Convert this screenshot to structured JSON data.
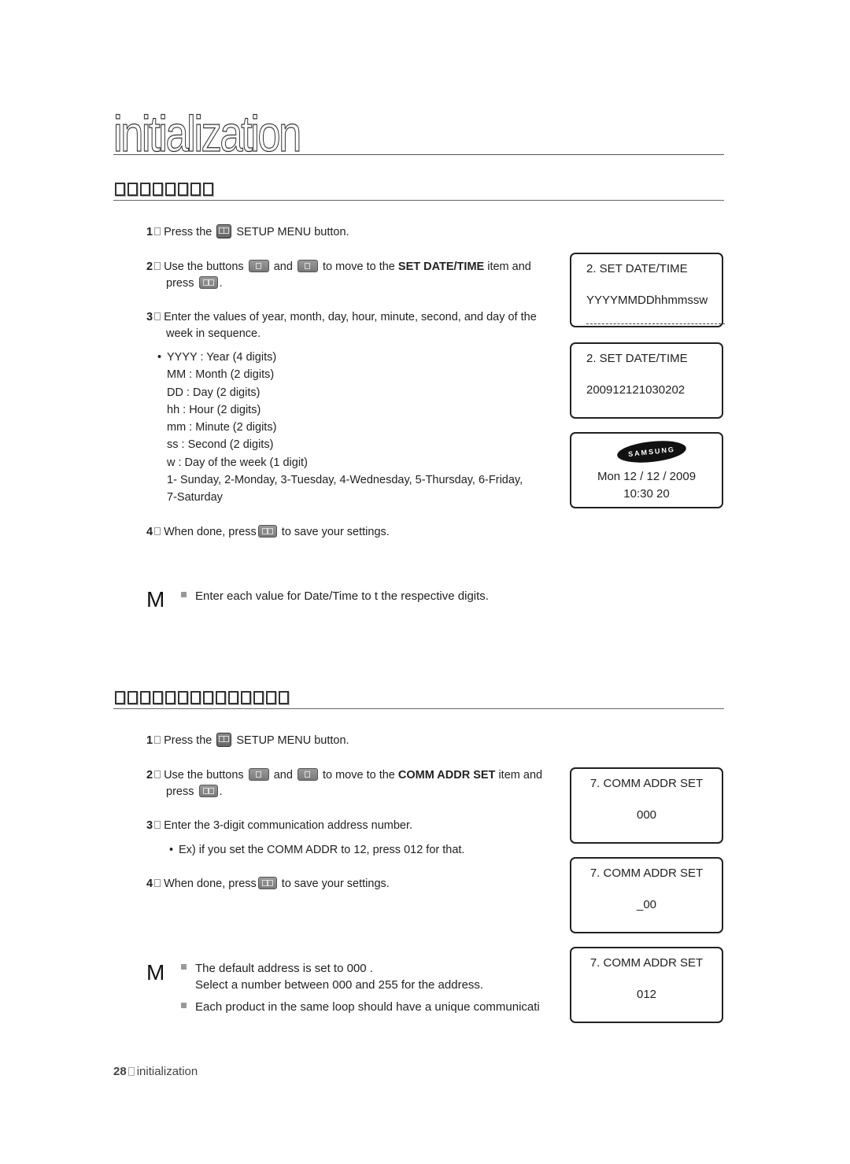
{
  "chapter": {
    "title": "initialization"
  },
  "section1": {
    "heading_glyph_count": 8,
    "steps": [
      {
        "num": "1",
        "parts": [
          "Press the",
          "SETUP MENU button."
        ]
      },
      {
        "num": "2",
        "parts": [
          "Use the buttons",
          "and",
          "to move to the",
          "SET DATE/TIME",
          "item and",
          "press",
          "."
        ]
      },
      {
        "num": "3",
        "parts": [
          "Enter the values of year, month, day, hour, minute, second, and day of the",
          "week in sequence."
        ]
      },
      {
        "num": "4",
        "parts": [
          "When done, press",
          "to save your settings."
        ]
      }
    ],
    "format_list": [
      "YYYY : Year (4 digits)",
      "MM : Month (2 digits)",
      "DD : Day (2 digits)",
      "hh : Hour (2 digits)",
      "mm : Minute (2 digits)",
      "ss : Second (2 digits)",
      "w : Day of the week (1 digit)",
      "1- Sunday, 2-Monday, 3-Tuesday, 4-Wednesday, 5-Thursday, 6-Friday,",
      "7-Saturday"
    ],
    "note_marker": "M",
    "notes": [
      "Enter each value for Date/Time to  t the respective digits."
    ],
    "screens": [
      {
        "line1": "2. SET DATE/TIME",
        "line2": "YYYYMMDDhhmmssw",
        "underline": "_______________"
      },
      {
        "line1": "2. SET DATE/TIME",
        "line2": "200912121030202"
      },
      {
        "logo": "SAMSUNG",
        "line1": "Mon 12 / 12 / 2009",
        "line2": "10:30 20"
      }
    ]
  },
  "section2": {
    "heading_glyph_count": 14,
    "steps": [
      {
        "num": "1",
        "parts": [
          "Press the",
          "SETUP MENU button."
        ]
      },
      {
        "num": "2",
        "parts": [
          "Use the buttons",
          "and",
          "to move to the",
          "COMM ADDR SET",
          "item and",
          "press",
          "."
        ]
      },
      {
        "num": "3",
        "parts": [
          "Enter the 3-digit communication address number."
        ]
      },
      {
        "num": "4",
        "parts": [
          "When done, press",
          "to save your settings."
        ]
      }
    ],
    "example": "Ex) if you set the COMM ADDR to 12, press 012 for that.",
    "note_marker": "M",
    "notes": [
      "The default address is set to  000 .",
      "Select a number between 000 and 255 for the address.",
      "Each product in the same loop should have a unique communicati"
    ],
    "screens": [
      {
        "line1": "7. COMM ADDR SET",
        "line2": "000"
      },
      {
        "line1": "7. COMM ADDR SET",
        "line2": "_00"
      },
      {
        "line1": "7. COMM ADDR SET",
        "line2": "012"
      }
    ]
  },
  "footer": {
    "page_number": "28",
    "label": "initialization"
  },
  "icons": {
    "setup_menu_button": "menu-button-icon",
    "up_button": "up-button-icon",
    "down_button": "down-button-icon",
    "enter_button": "enter-button-icon"
  }
}
